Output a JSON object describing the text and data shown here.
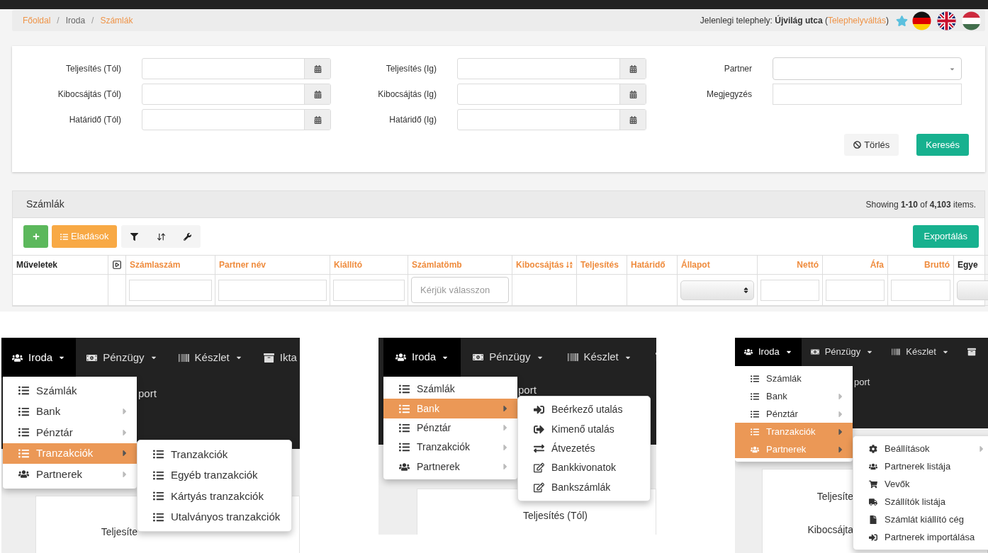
{
  "breadcrumb": {
    "separator": "/",
    "items": [
      {
        "label": "Főoldal",
        "link": true
      },
      {
        "label": "Iroda",
        "link": false
      },
      {
        "label": "Számlák",
        "link": true
      }
    ],
    "site": {
      "text_before": "Jelenlegi telephely: **Újvilág utca** (",
      "link": "Telephelyváltás",
      "text_after": ")"
    },
    "flags": [
      {
        "kind": "de"
      },
      {
        "kind": "gb"
      },
      {
        "kind": "hu"
      }
    ]
  },
  "filters": {
    "columns": [
      [
        {
          "label": "Teljesítés (Tól)",
          "kind": "date"
        },
        {
          "label": "Kibocsájtás (Tól)",
          "kind": "date"
        },
        {
          "label": "Határidő (Tól)",
          "kind": "date"
        }
      ],
      [
        {
          "label": "Teljesítés (Ig)",
          "kind": "date"
        },
        {
          "label": "Kibocsájtás (Ig)",
          "kind": "date"
        },
        {
          "label": "Határidő (Ig)",
          "kind": "date"
        }
      ],
      [
        {
          "label": "Partner",
          "kind": "select"
        },
        {
          "label": "Megjegyzés",
          "kind": "text"
        }
      ]
    ],
    "buttons": [
      {
        "label": "Törlés",
        "kind": "clear"
      },
      {
        "label": "Keresés",
        "kind": "search"
      }
    ]
  },
  "table_panel": {
    "title": "Számlák",
    "summary": "Showing **1-10** of **4,103** items.",
    "toolbar": [
      {
        "kind": "add"
      },
      {
        "kind": "list",
        "label": "Eladások"
      },
      {
        "kind": "filter"
      },
      {
        "kind": "sort"
      },
      {
        "kind": "settings"
      }
    ],
    "export": "Exportálás",
    "columns": [
      {
        "kind": "plain",
        "label": "Műveletek",
        "sortable": false,
        "sorted": false
      },
      {
        "kind": "icon"
      },
      {
        "kind": "text",
        "label": "Számlaszám",
        "sortable": true,
        "sorted": false
      },
      {
        "kind": "text",
        "label": "Partner név",
        "sortable": true,
        "sorted": false
      },
      {
        "kind": "text",
        "label": "Kiállító",
        "sortable": true,
        "sorted": false
      },
      {
        "kind": "dropdown",
        "label": "Számlatömb",
        "sortable": true,
        "sorted": false,
        "placeholder": "Kérjük válasszon"
      },
      {
        "kind": "plain",
        "label": "Kibocsájtás",
        "sortable": true,
        "sorted": true
      },
      {
        "kind": "plain",
        "label": "Teljesítés",
        "sortable": true,
        "sorted": false
      },
      {
        "kind": "plain",
        "label": "Határidő",
        "sortable": true,
        "sorted": false
      },
      {
        "kind": "status",
        "label": "Állapot",
        "sortable": true,
        "sorted": false
      },
      {
        "kind": "amount",
        "label": "Nettó",
        "sortable": true,
        "sorted": false
      },
      {
        "kind": "amount",
        "label": "Áfa",
        "sortable": true,
        "sorted": false
      },
      {
        "kind": "amount",
        "label": "Bruttó",
        "sortable": true,
        "sorted": false
      },
      {
        "kind": "select",
        "label": "Egye",
        "sortable": false,
        "sorted": false
      }
    ]
  },
  "menu_panels": [
    {
      "nav": [
        {
          "label": "Iroda",
          "kind": "users",
          "active": true,
          "caret": true
        },
        {
          "label": "Pénzügy",
          "kind": "money",
          "active": false,
          "caret": true
        },
        {
          "label": "Készlet",
          "kind": "barcode",
          "active": false,
          "caret": true
        },
        {
          "label": "Ikta",
          "kind": "archive",
          "active": false,
          "caret": false
        }
      ],
      "background_text": "port",
      "form_labels": [
        "Teljesíte"
      ],
      "menu": [
        {
          "label": "Számlák",
          "kind": "list",
          "submenu": false,
          "selected": false
        },
        {
          "label": "Bank",
          "kind": "list",
          "submenu": true,
          "selected": false
        },
        {
          "label": "Pénztár",
          "kind": "list",
          "submenu": true,
          "selected": false
        },
        {
          "label": "Tranzakciók",
          "kind": "list",
          "submenu": true,
          "selected": true
        },
        {
          "label": "Partnerek",
          "kind": "users",
          "submenu": true,
          "selected": false
        }
      ],
      "submenu": [
        {
          "label": "Tranzakciók",
          "kind": "list",
          "submenu": false
        },
        {
          "label": "Egyéb tranzakciók",
          "kind": "list",
          "submenu": false
        },
        {
          "label": "Kártyás tranzakciók",
          "kind": "list",
          "submenu": false
        },
        {
          "label": "Utalványos tranzakciók",
          "kind": "list",
          "submenu": false
        }
      ]
    },
    {
      "nav": [
        {
          "label": "Iroda",
          "kind": "users",
          "active": true,
          "caret": true
        },
        {
          "label": "Pénzügy",
          "kind": "money",
          "active": false,
          "caret": true
        },
        {
          "label": "Készlet",
          "kind": "barcode",
          "active": false,
          "caret": true
        },
        {
          "kind": "archive",
          "active": false,
          "caret": false
        }
      ],
      "background_text": "port",
      "form_labels": [
        "Teljesítés (Tól)"
      ],
      "menu": [
        {
          "label": "Számlák",
          "kind": "list",
          "submenu": false,
          "selected": false
        },
        {
          "label": "Bank",
          "kind": "list",
          "submenu": true,
          "selected": true
        },
        {
          "label": "Pénztár",
          "kind": "list",
          "submenu": true,
          "selected": false
        },
        {
          "label": "Tranzakciók",
          "kind": "list",
          "submenu": true,
          "selected": false
        },
        {
          "label": "Partnerek",
          "kind": "users",
          "submenu": true,
          "selected": false
        }
      ],
      "submenu": [
        {
          "label": "Beérkező utalás",
          "kind": "signin",
          "submenu": false
        },
        {
          "label": "Kimenő utalás",
          "kind": "signout",
          "submenu": false
        },
        {
          "label": "Átvezetés",
          "kind": "exchange",
          "submenu": false
        },
        {
          "label": "Bankkivonatok",
          "kind": "edit",
          "submenu": false
        },
        {
          "label": "Bankszámlák",
          "kind": "edit",
          "submenu": false
        }
      ]
    },
    {
      "nav": [
        {
          "label": "Iroda",
          "kind": "users",
          "active": true,
          "caret": true
        },
        {
          "label": "Pénzügy",
          "kind": "money",
          "active": false,
          "caret": true
        },
        {
          "label": "Készlet",
          "kind": "barcode",
          "active": false,
          "caret": true
        },
        {
          "kind": "archive",
          "active": false,
          "caret": false
        }
      ],
      "background_text": "port",
      "form_labels": [
        "Teljesíte",
        "Kibocsájta"
      ],
      "menu": [
        {
          "label": "Számlák",
          "kind": "list",
          "submenu": false,
          "selected": false
        },
        {
          "label": "Bank",
          "kind": "list",
          "submenu": true,
          "selected": false
        },
        {
          "label": "Pénztár",
          "kind": "list",
          "submenu": true,
          "selected": false
        },
        {
          "label": "Tranzakciók",
          "kind": "list",
          "submenu": true,
          "selected": true
        },
        {
          "label": "Partnerek",
          "kind": "users",
          "submenu": true,
          "selected": true
        }
      ],
      "submenu": [
        {
          "label": "Beállítások",
          "kind": "cog",
          "submenu": true
        },
        {
          "label": "Partnerek listája",
          "kind": "users",
          "submenu": false
        },
        {
          "label": "Vevők",
          "kind": "cart",
          "submenu": false
        },
        {
          "label": "Szállítók listája",
          "kind": "truck",
          "submenu": false
        },
        {
          "label": "Számlát kiállító cég",
          "kind": "file",
          "submenu": false
        },
        {
          "label": "Partnerek importálása",
          "kind": "signin",
          "submenu": false
        }
      ]
    }
  ]
}
